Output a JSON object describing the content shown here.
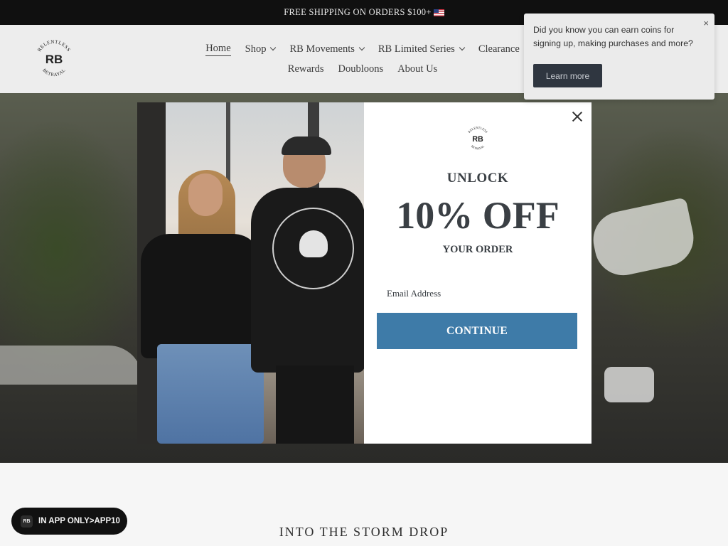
{
  "announcement": {
    "text": "FREE SHIPPING ON ORDERS $100+",
    "flag_icon": "us-flag-icon"
  },
  "brand": {
    "logo_top": "RELENTLESS",
    "logo_main": "RB",
    "logo_bottom": "BETRAYAL"
  },
  "nav": {
    "row1": [
      {
        "label": "Home",
        "active": true,
        "dropdown": false
      },
      {
        "label": "Shop",
        "dropdown": true
      },
      {
        "label": "RB Movements",
        "dropdown": true
      },
      {
        "label": "RB Limited Series",
        "dropdown": true
      },
      {
        "label": "Clearance",
        "dropdown": false
      }
    ],
    "row2": [
      {
        "label": "Rewards"
      },
      {
        "label": "Doubloons"
      },
      {
        "label": "About Us"
      }
    ]
  },
  "coins_popup": {
    "message": "Did you know you can earn coins for signing up, making purchases and more?",
    "close": "×",
    "button": "Learn more"
  },
  "modal": {
    "heading": "UNLOCK",
    "offer": "10% OFF",
    "subheading": "YOUR ORDER",
    "email_placeholder": "Email Address",
    "button": "CONTINUE"
  },
  "section": {
    "title": "INTO THE STORM DROP"
  },
  "app_badge": {
    "logo": "RB",
    "text": "IN APP ONLY>APP10"
  },
  "colors": {
    "accent_button": "#3e7ba8",
    "announcement_bg": "#101010",
    "heading_text": "#3a3f44"
  }
}
